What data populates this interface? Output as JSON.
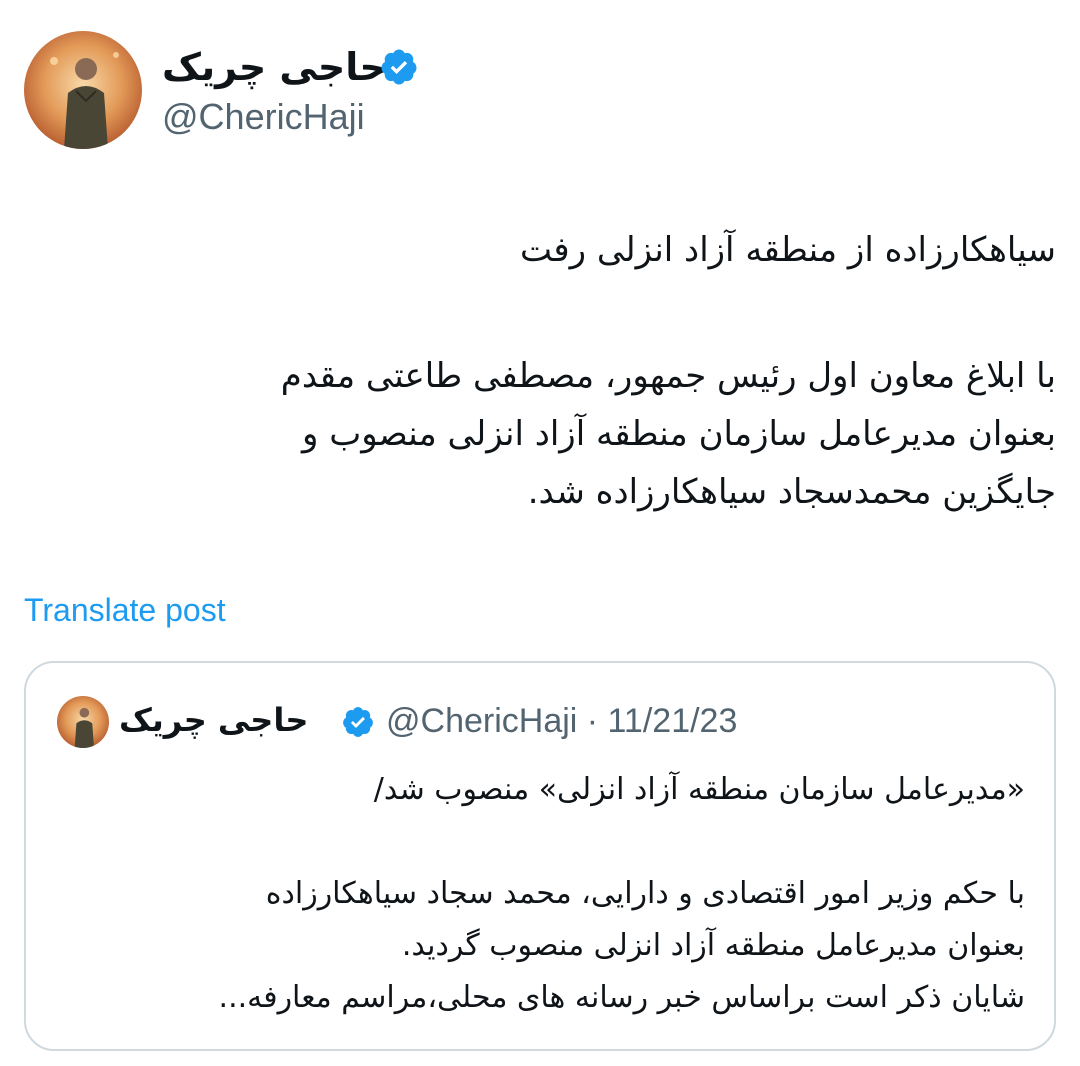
{
  "author": {
    "name": "حاجی چریک",
    "handle": "@ChericHaji",
    "verified": true,
    "avatar_icon": "person-portrait"
  },
  "tweet": {
    "lines": [
      "سیاهکارزاده از منطقه آزاد انزلی رفت",
      "با ابلاغ معاون اول رئیس جمهور، مصطفی طاعتی مقدم",
      "بعنوان مدیرعامل سازمان منطقه آزاد انزلی منصوب و",
      "جایگزین محمدسجاد سیاهکارزاده شد."
    ]
  },
  "translate_label": "Translate post",
  "quote": {
    "name": "حاجی چریک",
    "meta": "@ChericHaji · 11/21/23",
    "verified": true,
    "lines": [
      "«مدیرعامل سازمان منطقه آزاد انزلی» منصوب شد/",
      "با حکم وزیر امور اقتصادی و دارایی، محمد سجاد سیاهکارزاده",
      "بعنوان مدیرعامل منطقه آزاد انزلی منصوب گردید.",
      "شایان ذکر است براساس خبر رسانه های محلی،مراسم معارفه..."
    ]
  },
  "colors": {
    "accent": "#1d9bf0",
    "secondary_text": "#536471",
    "border": "#cfd9de"
  }
}
